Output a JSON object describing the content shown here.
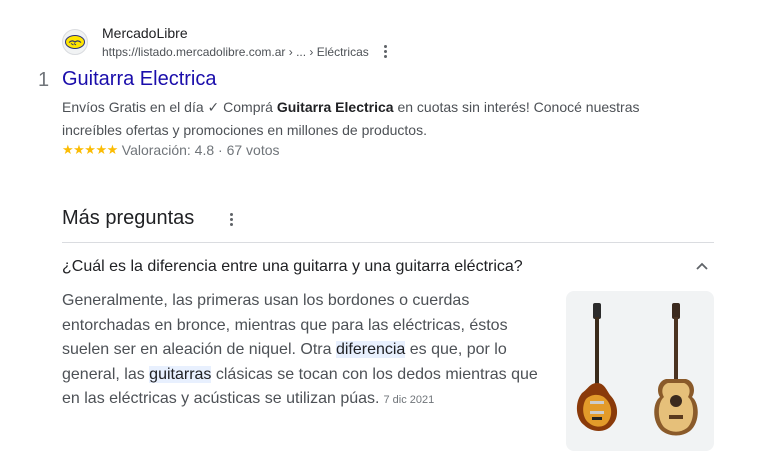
{
  "result": {
    "index": "1",
    "site_name": "MercadoLibre",
    "url": "https://listado.mercadolibre.com.ar › ... › Eléctricas",
    "title": "Guitarra Electrica",
    "snippet_1": "Envíos Gratis en el día ✓ Comprá ",
    "snippet_bold": "Guitarra Electrica",
    "snippet_2": " en cuotas sin interés! Conocé nuestras increíbles ofertas y promociones en millones de productos.",
    "stars": "★★★★★",
    "rating": "Valoración: 4.8 · 67 votos",
    "favicon_icon": "mercadolibre-handshake-icon",
    "menu_icon": "more-vert-icon"
  },
  "more_questions": {
    "title": "Más preguntas",
    "menu_icon": "more-vert-icon",
    "question": "¿Cuál es la diferencia entre una guitarra y una guitarra eléctrica?",
    "chevron_icon": "chevron-up-icon",
    "answer_1": "Generalmente, las primeras usan los bordones o cuerdas entorchadas en bronce, mientras que para las eléctricas, éstos suelen ser en aleación de niquel. Otra ",
    "answer_hl_1": "diferencia",
    "answer_2": " es que, por lo general, las ",
    "answer_hl_2": "guitarras",
    "answer_3": " clásicas se tocan con los dedos mientras que en las eléctricas y acústicas se utilizan púas.",
    "date": "7 dic 2021"
  },
  "colors": {
    "link": "#1a0dab",
    "star": "#fbbc04",
    "highlight": "#e8f0fe"
  }
}
